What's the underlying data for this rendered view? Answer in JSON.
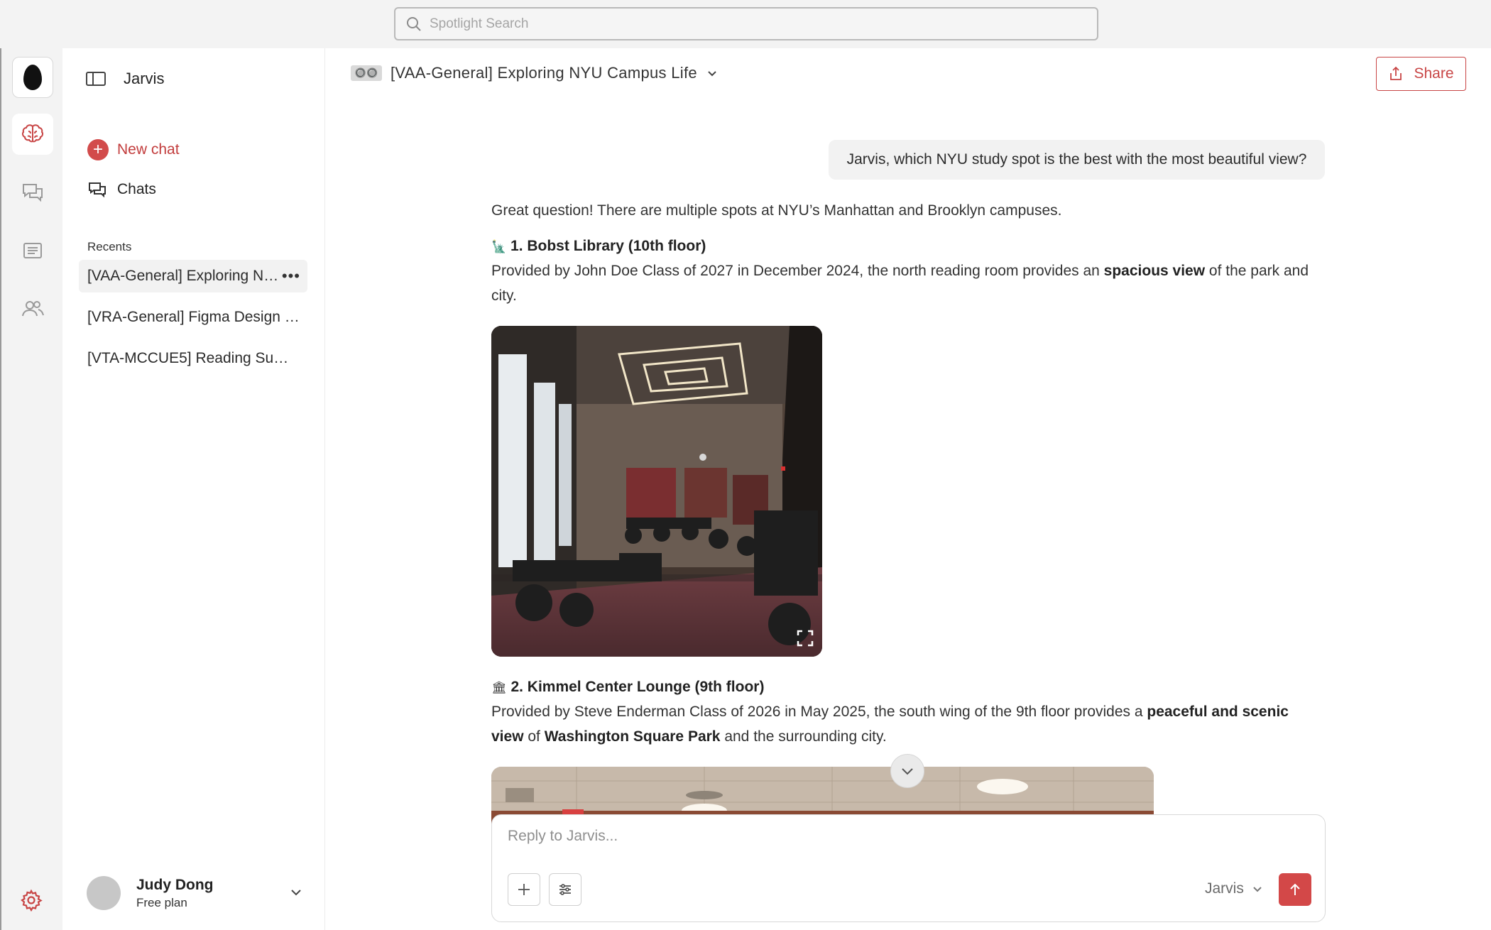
{
  "spotlight": {
    "placeholder": "Spotlight Search"
  },
  "sidebar": {
    "app_name": "Jarvis",
    "new_chat": "New chat",
    "chats": "Chats",
    "recents_heading": "Recents",
    "recents": [
      {
        "label": "[VAA-General] Exploring NYU Campus Life",
        "active": true
      },
      {
        "label": "[VRA-General] Figma Design System Review",
        "active": false
      },
      {
        "label": "[VTA-MCCUE5] Reading Summary Notes",
        "active": false
      }
    ],
    "user": {
      "name": "Judy Dong",
      "plan": "Free plan"
    }
  },
  "header": {
    "project_icon": "🔘🔘",
    "title": "[VAA-General] Exploring NYU Campus Life",
    "share_label": "Share"
  },
  "conversation": {
    "user_message": "Jarvis, which NYU study spot is the best with the most beautiful view?",
    "intro": "Great question! There are multiple spots at NYU’s Manhattan and Brooklyn campuses.",
    "spots": [
      {
        "emoji": "🗽",
        "heading": "1. Bobst Library (10th floor)",
        "text_before": "Provided by John Doe Class of 2027 in December 2024, the north reading room provides an ",
        "bold_1": "spacious view",
        "text_middle": " of the park and city.",
        "bold_2": "",
        "text_after": ""
      },
      {
        "emoji": "🏛",
        "heading": "2. Kimmel Center Lounge (9th floor)",
        "text_before": "Provided by Steve Enderman Class of 2026 in May 2025, the south wing of the 9th floor provides a ",
        "bold_1": "peaceful and scenic view",
        "text_middle": " of ",
        "bold_2": "Washington Square Park",
        "text_after": " and the surrounding city."
      }
    ]
  },
  "composer": {
    "placeholder": "Reply to Jarvis...",
    "model": "Jarvis"
  },
  "colors": {
    "accent": "#d24b4b",
    "sidebar_bg": "#ffffff",
    "rail_bg": "#f3f3f3"
  }
}
